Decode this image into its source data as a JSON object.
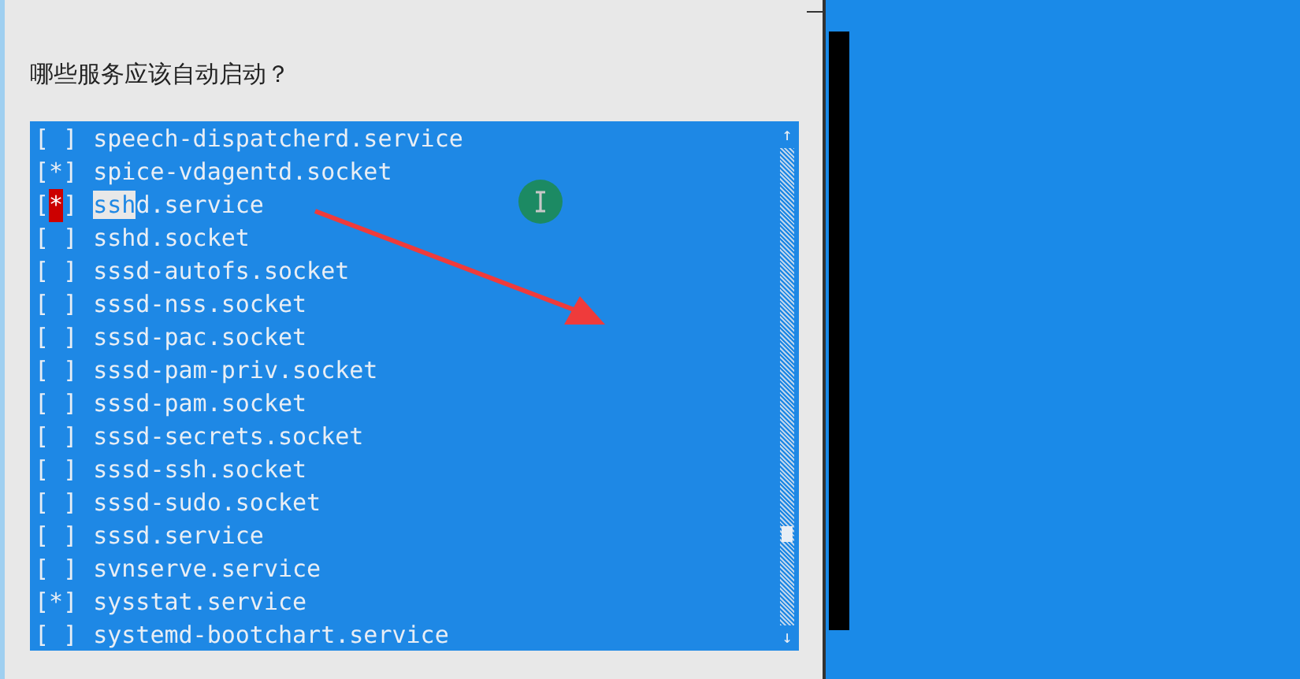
{
  "dialog": {
    "question": "哪些服务应该自动启动？"
  },
  "list": {
    "box_open": "[",
    "box_close": "]",
    "mark": "*",
    "scroll_up": "↑",
    "scroll_down": "↓",
    "items": [
      {
        "label": "speech-dispatcherd.service",
        "checked": false,
        "focused": false
      },
      {
        "label": "spice-vdagentd.socket",
        "checked": true,
        "focused": false
      },
      {
        "highlight": "ssh",
        "label": "d.service",
        "checked": true,
        "focused": true
      },
      {
        "label": "sshd.socket",
        "checked": false,
        "focused": false
      },
      {
        "label": "sssd-autofs.socket",
        "checked": false,
        "focused": false
      },
      {
        "label": "sssd-nss.socket",
        "checked": false,
        "focused": false
      },
      {
        "label": "sssd-pac.socket",
        "checked": false,
        "focused": false
      },
      {
        "label": "sssd-pam-priv.socket",
        "checked": false,
        "focused": false
      },
      {
        "label": "sssd-pam.socket",
        "checked": false,
        "focused": false
      },
      {
        "label": "sssd-secrets.socket",
        "checked": false,
        "focused": false
      },
      {
        "label": "sssd-ssh.socket",
        "checked": false,
        "focused": false
      },
      {
        "label": "sssd-sudo.socket",
        "checked": false,
        "focused": false
      },
      {
        "label": "sssd.service",
        "checked": false,
        "focused": false
      },
      {
        "label": "svnserve.service",
        "checked": false,
        "focused": false
      },
      {
        "label": "sysstat.service",
        "checked": true,
        "focused": false
      },
      {
        "label": "systemd-bootchart.service",
        "checked": false,
        "focused": false
      }
    ]
  }
}
